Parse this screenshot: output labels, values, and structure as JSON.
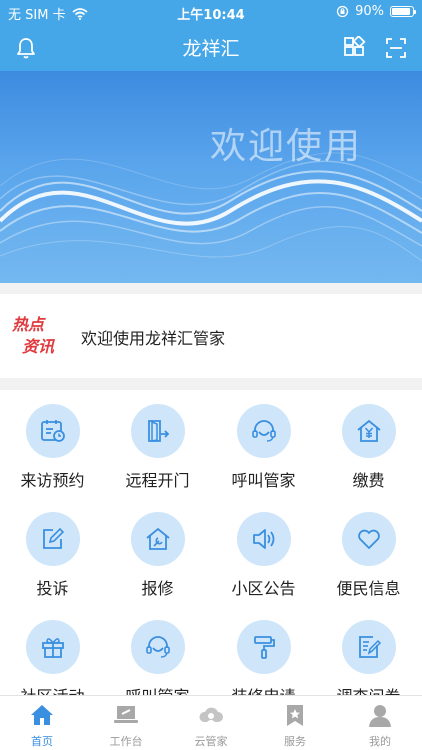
{
  "status_bar": {
    "carrier": "无 SIM 卡",
    "time": "上午10:44",
    "battery": "90%"
  },
  "nav": {
    "title": "龙祥汇"
  },
  "banner": {
    "text": "欢迎使用"
  },
  "news": {
    "tag_line1": "热点",
    "tag_line2": "资讯",
    "text": "欢迎使用龙祥汇管家"
  },
  "grid": [
    {
      "label": "来访预约",
      "icon": "calendar-clock-icon"
    },
    {
      "label": "远程开门",
      "icon": "remote-door-icon"
    },
    {
      "label": "呼叫管家",
      "icon": "headset-icon"
    },
    {
      "label": "缴费",
      "icon": "yen-house-icon"
    },
    {
      "label": "投诉",
      "icon": "edit-icon"
    },
    {
      "label": "报修",
      "icon": "repair-house-icon"
    },
    {
      "label": "小区公告",
      "icon": "speaker-icon"
    },
    {
      "label": "便民信息",
      "icon": "heart-icon"
    },
    {
      "label": "社区活动",
      "icon": "gift-icon"
    },
    {
      "label": "呼叫管家",
      "icon": "headset-icon"
    },
    {
      "label": "装修申请",
      "icon": "paint-roller-icon"
    },
    {
      "label": "调查问卷",
      "icon": "survey-icon"
    }
  ],
  "tabs": [
    {
      "label": "首页",
      "active": true
    },
    {
      "label": "工作台",
      "active": false
    },
    {
      "label": "云管家",
      "active": false
    },
    {
      "label": "服务",
      "active": false
    },
    {
      "label": "我的",
      "active": false
    }
  ],
  "colors": {
    "primary": "#45a7e8",
    "icon_bg": "#cfe6fa",
    "icon_stroke": "#3a8fe0",
    "hot_tag": "#e0393e"
  }
}
